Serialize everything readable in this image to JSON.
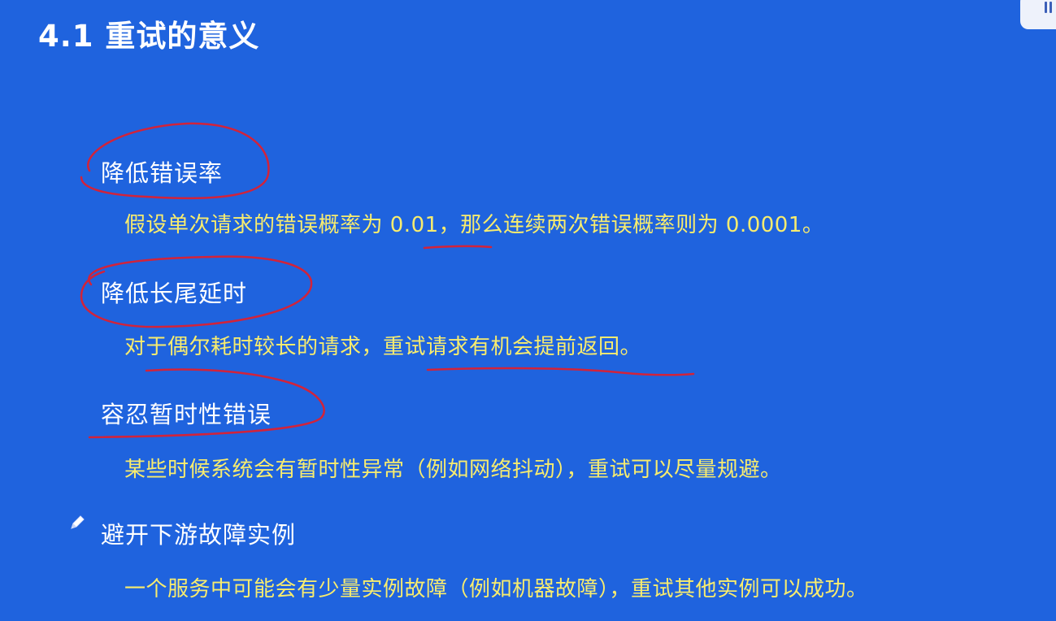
{
  "slide": {
    "title": "4.1 重试的意义",
    "sections": [
      {
        "heading": "降低错误率",
        "detail": "假设单次请求的错误概率为 0.01，那么连续两次错误概率则为 0.0001。"
      },
      {
        "heading": "降低长尾延时",
        "detail": "对于偶尔耗时较长的请求，重试请求有机会提前返回。"
      },
      {
        "heading": "容忍暂时性错误",
        "detail": "某些时候系统会有暂时性异常（例如网络抖动），重试可以尽量规避。"
      },
      {
        "heading": "避开下游故障实例",
        "detail": "一个服务中可能会有少量实例故障（例如机器故障），重试其他实例可以成功。"
      }
    ]
  },
  "colors": {
    "background": "#1f63de",
    "heading_text": "#ffffff",
    "detail_text": "#f8ec6e",
    "annotation_ink": "#d2233a"
  },
  "icons": {
    "annotation_tool": "pencil-icon",
    "corner_widget": "toolbar-icon"
  }
}
